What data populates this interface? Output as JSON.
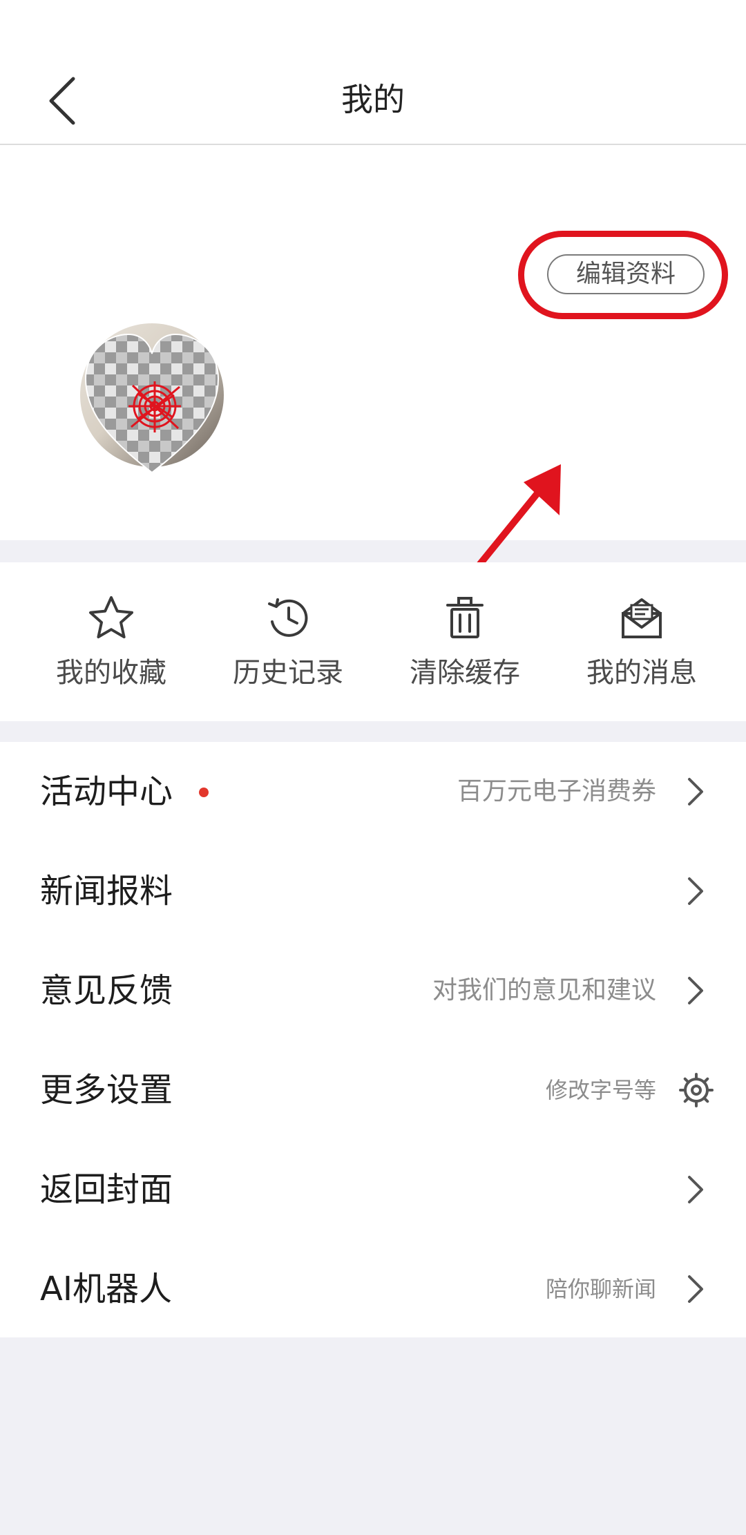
{
  "header": {
    "title": "我的"
  },
  "profile": {
    "edit_label": "编辑资料"
  },
  "quick_actions": [
    {
      "label": "我的收藏",
      "icon": "star-icon"
    },
    {
      "label": "历史记录",
      "icon": "history-icon"
    },
    {
      "label": "清除缓存",
      "icon": "trash-icon"
    },
    {
      "label": "我的消息",
      "icon": "mail-icon"
    }
  ],
  "menu": [
    {
      "title": "活动中心",
      "subtitle": "百万元电子消费券",
      "has_dot": true,
      "trailing": "chevron-right-icon"
    },
    {
      "title": "新闻报料",
      "subtitle": "",
      "trailing": "chevron-right-icon"
    },
    {
      "title": "意见反馈",
      "subtitle": "对我们的意见和建议",
      "trailing": "chevron-right-icon"
    },
    {
      "title": "更多设置",
      "subtitle": "修改字号等",
      "trailing": "gear-icon"
    },
    {
      "title": "返回封面",
      "subtitle": "",
      "trailing": "chevron-right-icon"
    },
    {
      "title": "AI机器人",
      "subtitle": "陪你聊新闻",
      "trailing": "chevron-right-icon"
    }
  ],
  "colors": {
    "accent_red": "#e0141e",
    "dot_red": "#e2372c",
    "page_bg": "#f0f0f5"
  }
}
